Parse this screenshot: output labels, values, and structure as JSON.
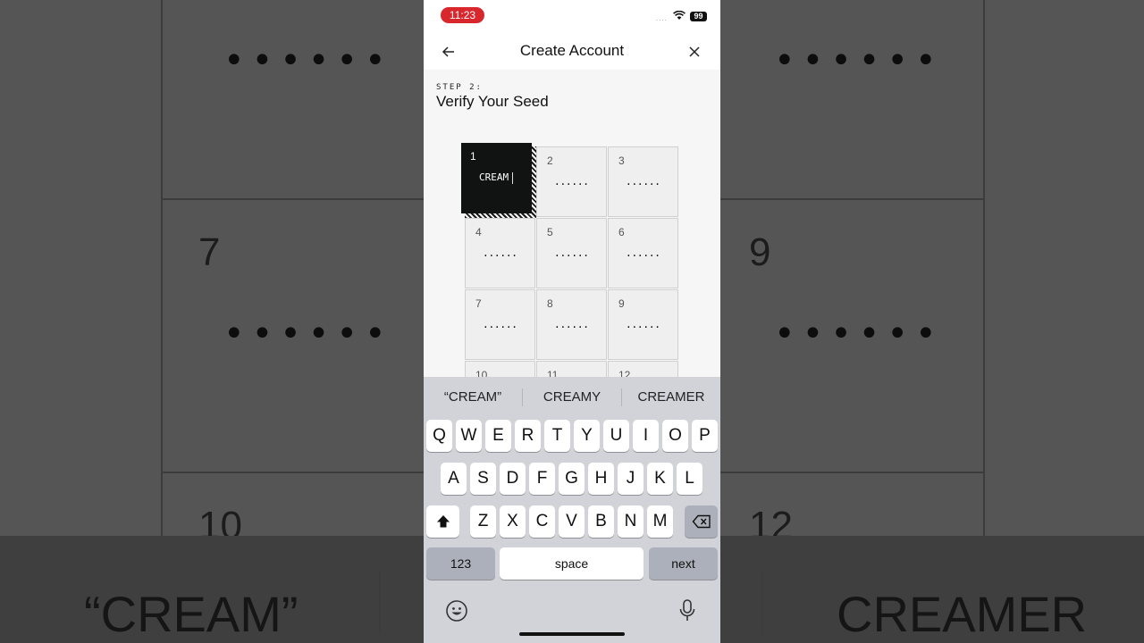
{
  "background": {
    "numbers": [
      "7",
      "9",
      "10",
      "12"
    ],
    "dots": "••••••",
    "suggestions": [
      "“CREAM”",
      "CREAMER"
    ]
  },
  "status_bar": {
    "time": "11:23",
    "battery": "99",
    "signal": "....",
    "accent": "#d9272e"
  },
  "header": {
    "title": "Create Account",
    "back_icon": "arrow-left-icon",
    "close_icon": "close-icon"
  },
  "step": {
    "label": "STEP 2:",
    "title": "Verify Your Seed"
  },
  "seed_grid": {
    "active": {
      "number": "1",
      "word": "CREAM"
    },
    "cells": [
      {
        "number": "2",
        "value": "......"
      },
      {
        "number": "3",
        "value": "......"
      },
      {
        "number": "4",
        "value": "......"
      },
      {
        "number": "5",
        "value": "......"
      },
      {
        "number": "6",
        "value": "......"
      },
      {
        "number": "7",
        "value": "......"
      },
      {
        "number": "8",
        "value": "......"
      },
      {
        "number": "9",
        "value": "......"
      },
      {
        "number": "10",
        "value": ""
      },
      {
        "number": "11",
        "value": ""
      },
      {
        "number": "12",
        "value": ""
      }
    ]
  },
  "keyboard": {
    "suggestions": [
      "“CREAM”",
      "CREAMY",
      "CREAMER"
    ],
    "row1": [
      "Q",
      "W",
      "E",
      "R",
      "T",
      "Y",
      "U",
      "I",
      "O",
      "P"
    ],
    "row2": [
      "A",
      "S",
      "D",
      "F",
      "G",
      "H",
      "J",
      "K",
      "L"
    ],
    "row3": [
      "Z",
      "X",
      "C",
      "V",
      "B",
      "N",
      "M"
    ],
    "numbers_key": "123",
    "space_key": "space",
    "next_key": "next",
    "shift_icon": "shift-icon",
    "backspace_icon": "backspace-icon",
    "emoji_icon": "emoji-icon",
    "mic_icon": "microphone-icon"
  }
}
